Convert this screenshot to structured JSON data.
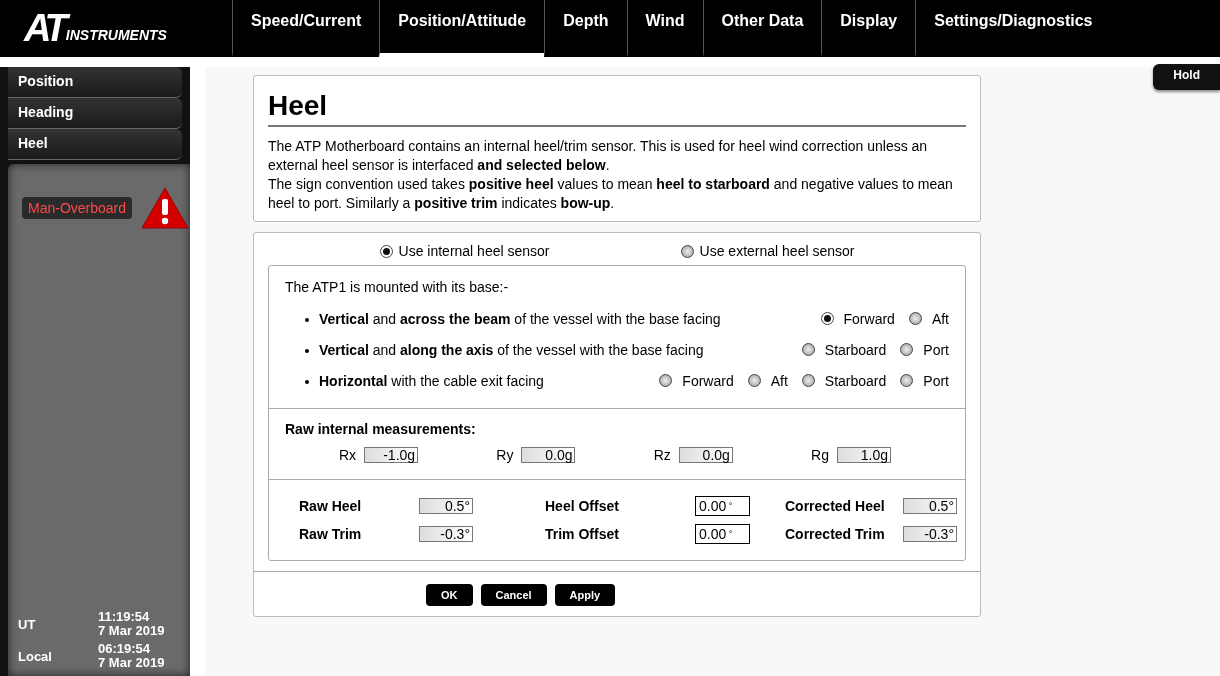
{
  "logo": {
    "mark": "AT",
    "text": "INSTRUMENTS"
  },
  "tabs": [
    {
      "label": "Speed/Current",
      "selected": false
    },
    {
      "label": "Position/Attitude",
      "selected": true
    },
    {
      "label": "Depth",
      "selected": false
    },
    {
      "label": "Wind",
      "selected": false
    },
    {
      "label": "Other Data",
      "selected": false
    },
    {
      "label": "Display",
      "selected": false
    },
    {
      "label": "Settings/Diagnostics",
      "selected": false
    }
  ],
  "sidebar": {
    "items": [
      "Position",
      "Heading",
      "Heel"
    ],
    "alarm": "Man-Overboard",
    "clocks": [
      {
        "label": "UT",
        "time": "11:19:54",
        "date": "7 Mar 2019"
      },
      {
        "label": "Local",
        "time": "06:19:54",
        "date": "7 Mar 2019"
      }
    ]
  },
  "hold_button": "Hold",
  "title": "Heel",
  "paragraphs": [
    "The ATP Motherboard contains an internal heel/trim sensor. This is used for heel wind correction unless an external heel sensor is interfaced **and selected below**.",
    "The sign convention used takes **positive heel** values to mean **heel to starboard** and negative values to mean heel to port. Similarly a **positive trim** indicates **bow-up**."
  ],
  "sensor_options": [
    {
      "label": "Use internal heel sensor",
      "selected": true
    },
    {
      "label": "Use external heel sensor",
      "selected": false
    }
  ],
  "mount_intro": "The ATP1 is mounted with its base:-",
  "mount_rows": [
    {
      "text": "**Vertical** and **across the beam** of the vessel with the base facing",
      "options": [
        {
          "label": "Forward",
          "selected": true
        },
        {
          "label": "Aft",
          "selected": false
        }
      ]
    },
    {
      "text": "**Vertical** and **along the axis** of the vessel with the base facing",
      "options": [
        {
          "label": "Starboard",
          "selected": false
        },
        {
          "label": "Port",
          "selected": false
        }
      ]
    },
    {
      "text": "**Horizontal** with the cable exit facing",
      "options": [
        {
          "label": "Forward",
          "selected": false
        },
        {
          "label": "Aft",
          "selected": false
        },
        {
          "label": "Starboard",
          "selected": false
        },
        {
          "label": "Port",
          "selected": false
        }
      ]
    }
  ],
  "measurements_title": "Raw internal measurements:",
  "measurements": [
    {
      "label": "Rx",
      "value": "-1.0g"
    },
    {
      "label": "Ry",
      "value": "0.0g"
    },
    {
      "label": "Rz",
      "value": "0.0g"
    },
    {
      "label": "Rg",
      "value": "1.0g"
    }
  ],
  "angles": [
    {
      "label": "Raw Heel",
      "value": "0.5°",
      "kind": "readonly"
    },
    {
      "label": "Heel Offset",
      "value": "0.00",
      "unit": "°",
      "kind": "editable"
    },
    {
      "label": "Corrected Heel",
      "value": "0.5°",
      "kind": "readonly"
    },
    {
      "label": "Raw Trim",
      "value": "-0.3°",
      "kind": "readonly"
    },
    {
      "label": "Trim Offset",
      "value": "0.00",
      "unit": "°",
      "kind": "editable"
    },
    {
      "label": "Corrected Trim",
      "value": "-0.3°",
      "kind": "readonly"
    }
  ],
  "buttons": [
    "OK",
    "Cancel",
    "Apply"
  ]
}
